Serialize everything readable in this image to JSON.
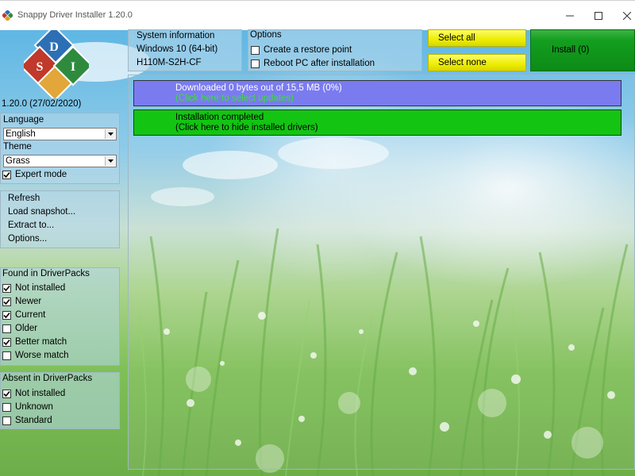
{
  "window": {
    "title": "Snappy Driver Installer 1.20.0",
    "controls": [
      "minimize",
      "maximize",
      "close"
    ]
  },
  "logo": {
    "letters": [
      "S",
      "D",
      "I"
    ]
  },
  "version": "1.20.0 (27/02/2020)",
  "settings": {
    "language_label": "Language",
    "language_value": "English",
    "theme_label": "Theme",
    "theme_value": "Grass",
    "expert_mode_label": "Expert mode",
    "expert_mode_checked": true
  },
  "actions": [
    "Refresh",
    "Load snapshot...",
    "Extract to...",
    "Options..."
  ],
  "found_in_driverpacks": {
    "title": "Found in DriverPacks",
    "items": [
      {
        "label": "Not installed",
        "checked": true
      },
      {
        "label": "Newer",
        "checked": true
      },
      {
        "label": "Current",
        "checked": true
      },
      {
        "label": "Older",
        "checked": false
      },
      {
        "label": "Better match",
        "checked": true
      },
      {
        "label": "Worse match",
        "checked": false
      }
    ]
  },
  "absent_in_driverpacks": {
    "title": "Absent in DriverPacks",
    "items": [
      {
        "label": "Not installed",
        "checked": true
      },
      {
        "label": "Unknown",
        "checked": false
      },
      {
        "label": "Standard",
        "checked": false
      }
    ]
  },
  "system_info": {
    "title": "System information",
    "os": "Windows 10 (64-bit)",
    "board": "H110M-S2H-CF"
  },
  "options": {
    "title": "Options",
    "items": [
      {
        "label": "Create a restore point",
        "checked": false
      },
      {
        "label": "Reboot PC after installation",
        "checked": false
      }
    ]
  },
  "buttons": {
    "select_all": "Select all",
    "select_none": "Select none",
    "install": "Install (0)"
  },
  "status_bars": {
    "download_line1": "Downloaded 0 bytes out of 15,5 MB (0%)",
    "download_line2": "(Click here to select updates)",
    "install_line1": "Installation completed",
    "install_line2": "(Click here to hide installed drivers)"
  },
  "colors": {
    "download_bar": "#7b7bf0",
    "install_bar": "#13c413",
    "select_buttons": "#eded00",
    "install_button": "#139f1f"
  }
}
